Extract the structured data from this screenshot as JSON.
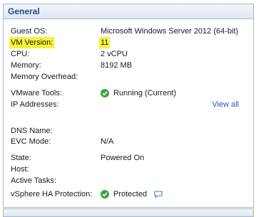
{
  "panel": {
    "title": "General",
    "rows": {
      "guest_os": {
        "label": "Guest OS:",
        "value": "Microsoft Windows Server 2012 (64-bit)"
      },
      "vm_version": {
        "label": "VM Version:",
        "value": "11"
      },
      "cpu": {
        "label": "CPU:",
        "value": "2 vCPU"
      },
      "memory": {
        "label": "Memory:",
        "value": "8192 MB"
      },
      "memory_overhead": {
        "label": "Memory Overhead:",
        "value": ""
      },
      "vmware_tools": {
        "label": "VMware Tools:",
        "value": "Running (Current)"
      },
      "ip_addresses": {
        "label": "IP Addresses:",
        "link": "View all"
      },
      "dns_name": {
        "label": "DNS Name:",
        "value": ""
      },
      "evc_mode": {
        "label": "EVC Mode:",
        "value": "N/A"
      },
      "state": {
        "label": "State:",
        "value": "Powered On"
      },
      "host": {
        "label": "Host:",
        "value": ""
      },
      "active_tasks": {
        "label": "Active Tasks:",
        "value": ""
      },
      "vsphere_ha": {
        "label": "vSphere HA Protection:",
        "value": "Protected"
      }
    }
  },
  "colors": {
    "highlight": "#f7f23a",
    "status_ok": "#3aa53a",
    "link": "#1f5fb8",
    "header_text": "#1f4a8a"
  }
}
